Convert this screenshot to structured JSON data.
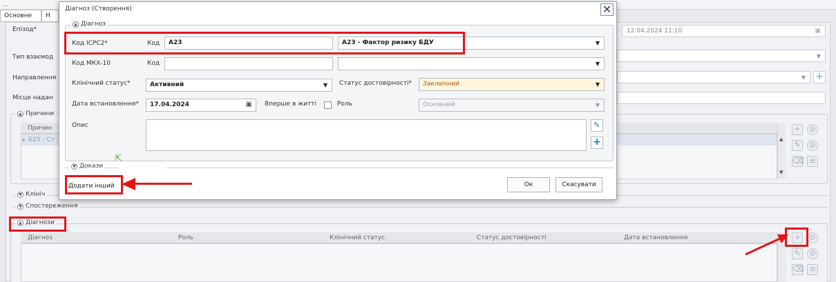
{
  "app": {
    "title_fragment": "...",
    "tabs": [
      {
        "label": "Основне"
      },
      {
        "label": "Н"
      }
    ],
    "fields": {
      "episode_label": "Епізод*",
      "episode_date": "12.04.2024 11:10",
      "interaction_type_label": "Тип взаємод",
      "referral_label": "Направлення",
      "service_place_label": "Місце надан"
    },
    "reasons_group": {
      "title": "Причини",
      "col_header": "Причин",
      "row_value": "Б25 - Ст"
    },
    "clinical_group_title": "Клініч",
    "observations_group_title": "Спостереження",
    "diagnoses_group": {
      "title": "Діагнози",
      "columns": [
        "Діагноз",
        "Роль",
        "Клінічний статус",
        "Статус достовірності",
        "Дата встановлення"
      ]
    }
  },
  "dialog": {
    "title": "Діагноз (Створення)",
    "close_symbol": "✕",
    "group_title": "Діагноз",
    "icpc2_label": "Код ICPC2*",
    "icpc2_code_label": "Код",
    "icpc2_code_value": "A23",
    "icpc2_desc_value": "A23 - Фактор ризику БДУ",
    "mkh10_label": "Код МКХ-10",
    "mkh10_code_label": "Код",
    "mkh10_code_value": "",
    "mkh10_desc_value": "",
    "clinical_status_label": "Клінічний статус*",
    "clinical_status_value": "Активний",
    "verification_status_label": "Статус достовірності*",
    "verification_status_value": "Заключний",
    "established_date_label": "Дата встановлення*",
    "established_date_value": "17.04.2024",
    "first_in_life_label": "Вперше в житті",
    "role_label": "Роль",
    "role_value": "Основний",
    "description_label": "Опис",
    "evidence_group_title": "Докази",
    "add_other_label": "Додати інший",
    "ok_label": "Ок",
    "cancel_label": "Скасувати"
  },
  "colors": {
    "annotation_red": "#e3151a",
    "accent_blue": "#2a6fbf",
    "warning_yellow_bg": "#fdf6dc"
  },
  "icons": [
    "close-icon",
    "chevron-down-icon",
    "calendar-icon",
    "edit-icon",
    "plus-icon",
    "collapse-icon",
    "expand-icon",
    "arrow-annotation"
  ]
}
